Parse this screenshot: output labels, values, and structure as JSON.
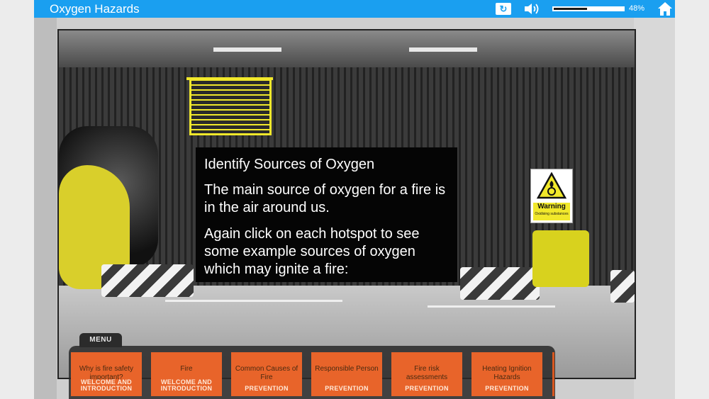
{
  "header": {
    "title": "Oxygen Hazards",
    "progress_fraction": 0.48,
    "progress_text": "48%",
    "replay_icon": "replay-icon",
    "volume_icon": "volume-icon",
    "home_icon": "home-icon",
    "accent_color": "#1a9ff0"
  },
  "info": {
    "heading": "Identify Sources of Oxygen",
    "paragraph1": "The main source of oxygen for a fire is in the air around us.",
    "paragraph2": "Again click on each hotspot to see some example sources of oxygen which may ignite a fire:"
  },
  "sign": {
    "title": "Warning",
    "subtitle": "Oxidising substances"
  },
  "menu": {
    "label": "MENU",
    "items": [
      {
        "title": "Why is fire safety important?",
        "section": "WELCOME AND INTRODUCTION"
      },
      {
        "title": "Fire",
        "section": "WELCOME AND INTRODUCTION"
      },
      {
        "title": "Common Causes of Fire",
        "section": "PREVENTION"
      },
      {
        "title": "Responsible Person",
        "section": "PREVENTION"
      },
      {
        "title": "Fire risk assessments",
        "section": "PREVENTION"
      },
      {
        "title": "Heating Ignition Hazards",
        "section": "PREVENTION"
      }
    ]
  }
}
